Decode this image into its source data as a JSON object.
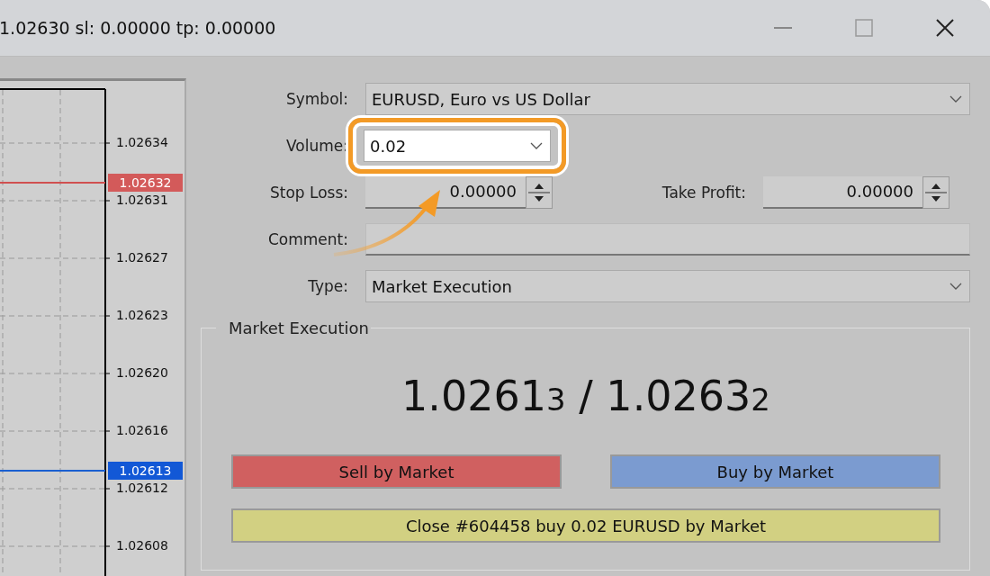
{
  "window": {
    "title": "1.02630 sl: 0.00000 tp: 0.00000"
  },
  "chart": {
    "price_labels": [
      "1.02634",
      "1.02631",
      "1.02627",
      "1.02623",
      "1.02620",
      "1.02616",
      "1.02612",
      "1.02608"
    ],
    "ask_label": "1.02632",
    "bid_label": "1.02613"
  },
  "form": {
    "symbol_label": "Symbol:",
    "symbol": "EURUSD, Euro vs US Dollar",
    "volume_label": "Volume:",
    "volume": "0.02",
    "volume_highlighted": true,
    "stop_loss_label": "Stop Loss:",
    "stop_loss": "0.00000",
    "take_profit_label": "Take Profit:",
    "take_profit": "0.00000",
    "comment_label": "Comment:",
    "type_label": "Type:",
    "type": "Market Execution"
  },
  "execution": {
    "title": "Market Execution",
    "bid": {
      "main": "1.0261",
      "small": "3"
    },
    "separator": "/",
    "ask": {
      "main": "1.0263",
      "small": "2"
    },
    "buttons": [
      {
        "kind": "sell",
        "label": "Sell by Market"
      },
      {
        "kind": "buy",
        "label": "Buy by Market"
      },
      {
        "kind": "close",
        "label": "Close #604458 buy 0.02 EURUSD by Market"
      }
    ]
  }
}
